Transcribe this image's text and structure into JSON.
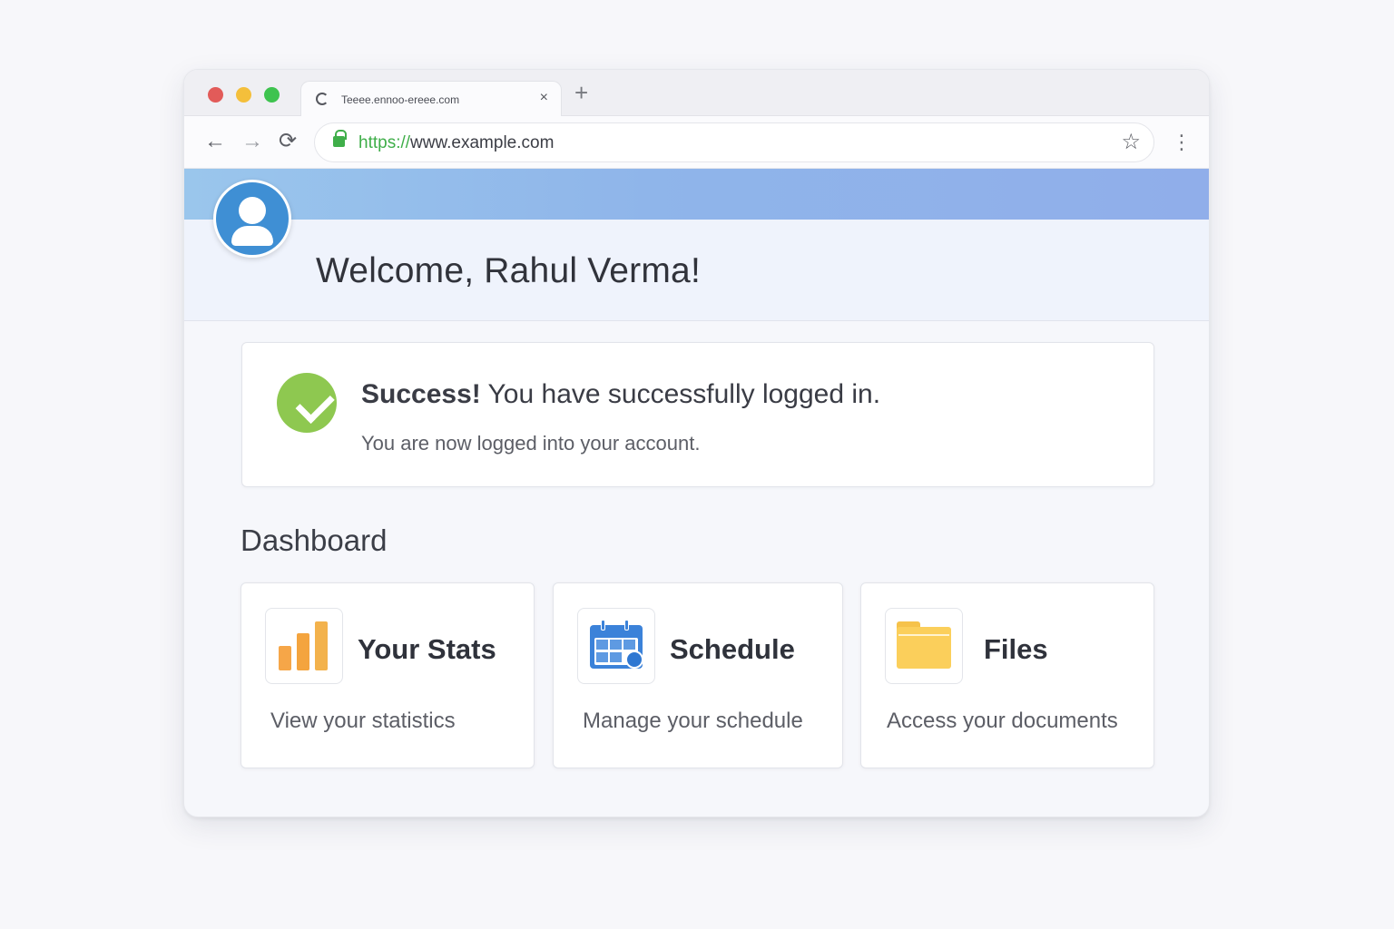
{
  "browser": {
    "tab_title": "Teeee.ennoo-ereee.com",
    "tab_close": "×",
    "new_tab": "+",
    "url_protocol": "https://",
    "url_rest": "www.example.com",
    "nav_back": "←",
    "nav_forward": "→",
    "nav_reload": "⟳",
    "star": "☆",
    "menu": "⋮"
  },
  "header": {
    "welcome": "Welcome, Rahul Verma!"
  },
  "alert": {
    "title_bold": "Success!",
    "title_rest": " You have successfully logged in.",
    "subtitle": "You are now logged into your account."
  },
  "dashboard": {
    "title": "Dashboard",
    "cards": [
      {
        "icon": "bar-chart-icon",
        "title": "Your Stats",
        "desc": "View your statistics"
      },
      {
        "icon": "calendar-icon",
        "title": "Schedule",
        "desc": "Manage your schedule"
      },
      {
        "icon": "folder-icon",
        "title": "Files",
        "desc": "Access your documents"
      }
    ]
  },
  "colors": {
    "success": "#8ec850",
    "avatar": "#3f8fd4",
    "banner": "#90aeea",
    "url_secure": "#3fae49"
  }
}
